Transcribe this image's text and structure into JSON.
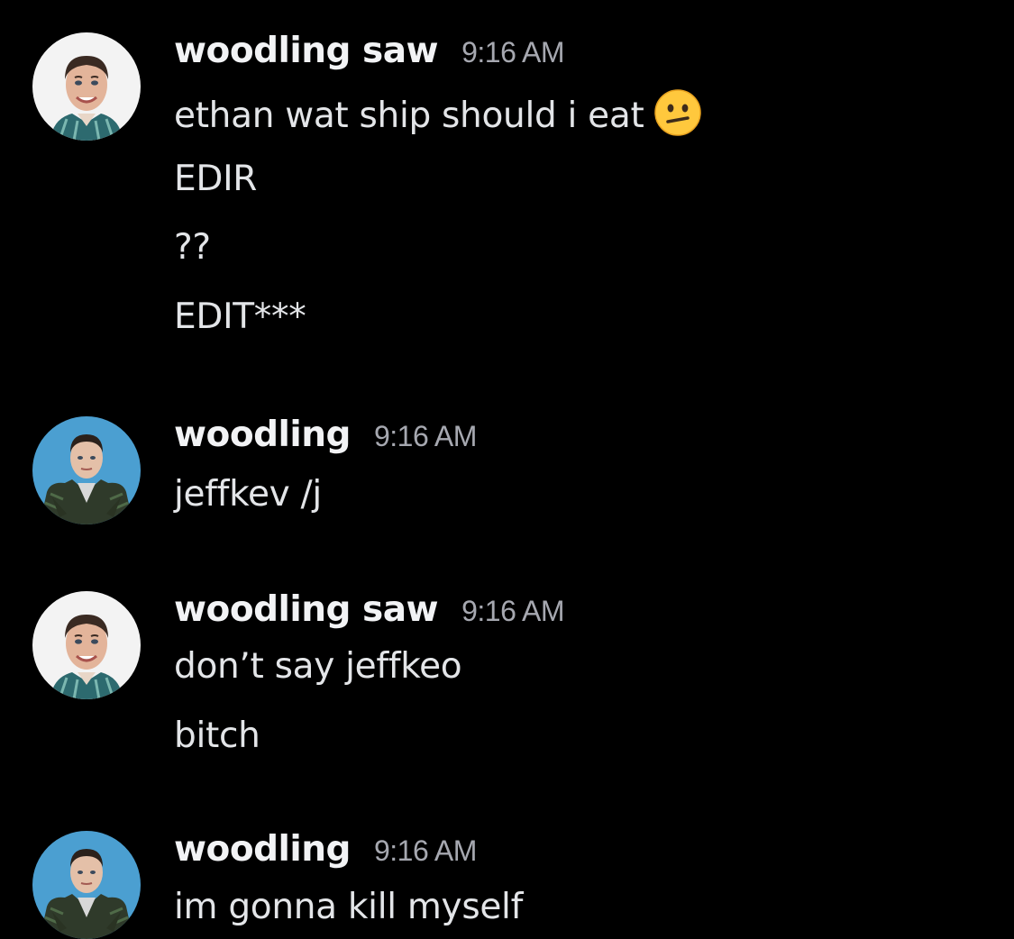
{
  "messages": [
    {
      "username": "woodling saw",
      "timestamp": "9:16 AM",
      "avatar": "portrait-smiling-man-icon",
      "lines": [
        "ethan wat ship should i eat",
        "EDIR",
        "??",
        "EDIT***"
      ],
      "emoji": "neutral-face-emoji"
    },
    {
      "username": "woodling",
      "timestamp": "9:16 AM",
      "avatar": "man-plaid-shirt-pose-icon",
      "lines": [
        "jeffkev /j"
      ]
    },
    {
      "username": "woodling saw",
      "timestamp": "9:16 AM",
      "avatar": "portrait-smiling-man-icon",
      "lines": [
        "don’t say jeffkeo",
        "bitch"
      ]
    },
    {
      "username": "woodling",
      "timestamp": "9:16 AM",
      "avatar": "man-plaid-shirt-pose-icon",
      "lines": [
        "im gonna kill myself"
      ]
    }
  ],
  "colors": {
    "background": "#000000",
    "username": "#f2f3f5",
    "timestamp": "#a6a8b0",
    "message_text": "#e3e5e8",
    "avatar_blue": "#4b9fd1"
  }
}
